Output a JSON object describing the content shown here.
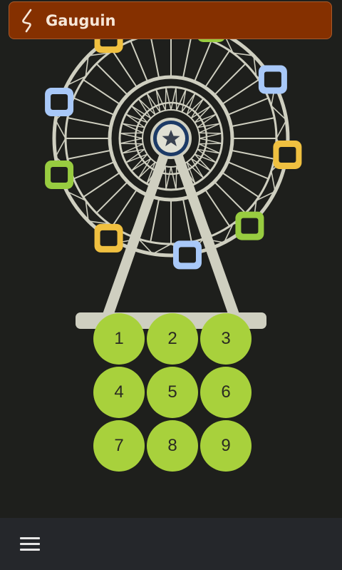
{
  "app": {
    "title": "Gauguin",
    "logo_icon": "gauguin-logo-icon"
  },
  "colors": {
    "title_bar": "#853000",
    "background": "#1e1f1c",
    "wheel": "#cfcfc0",
    "key_fill": "#a8d13c",
    "gondola_yellow": "#f0c040",
    "gondola_blue": "#a8c8f8",
    "gondola_green": "#98cc40",
    "hub_blue": "#1c3a66"
  },
  "wheel": {
    "hub_icon": "star-icon"
  },
  "keypad": {
    "keys": [
      {
        "label": "1"
      },
      {
        "label": "2"
      },
      {
        "label": "3"
      },
      {
        "label": "4"
      },
      {
        "label": "5"
      },
      {
        "label": "6"
      },
      {
        "label": "7"
      },
      {
        "label": "8"
      },
      {
        "label": "9"
      }
    ]
  },
  "bottom_bar": {
    "menu_icon": "hamburger-menu-icon"
  }
}
